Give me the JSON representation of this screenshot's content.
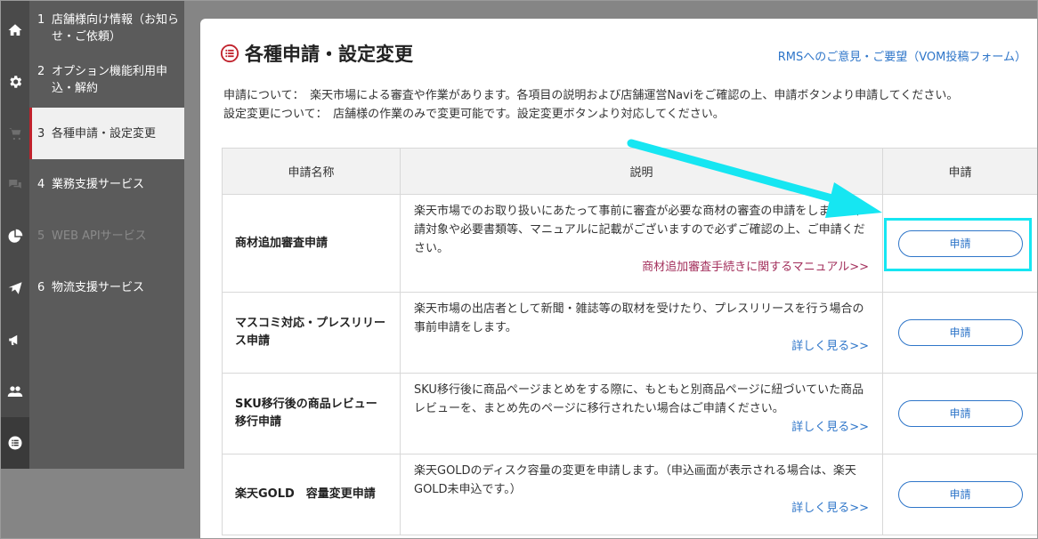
{
  "icon_bar": {
    "icons": [
      {
        "name": "home-icon"
      },
      {
        "name": "gear-icon"
      },
      {
        "name": "cart-icon"
      },
      {
        "name": "chat-icon"
      },
      {
        "name": "pie-chart-icon"
      },
      {
        "name": "paper-plane-icon"
      },
      {
        "name": "megaphone-icon"
      },
      {
        "name": "people-icon"
      },
      {
        "name": "list-icon"
      }
    ]
  },
  "menu": {
    "items": [
      {
        "num": "1",
        "label": "店舗様向け情報（お知らせ・ご依頼）"
      },
      {
        "num": "2",
        "label": "オプション機能利用申込・解約"
      },
      {
        "num": "3",
        "label": "各種申請・設定変更"
      },
      {
        "num": "4",
        "label": "業務支援サービス"
      },
      {
        "num": "5",
        "label": "WEB APIサービス"
      },
      {
        "num": "6",
        "label": "物流支援サービス"
      }
    ]
  },
  "page": {
    "title": "各種申請・設定変更",
    "feedback_link": "RMSへのご意見・ご要望（VOM投稿フォーム）",
    "desc_line1": "申請について：　楽天市場による審査や作業があります。各項目の説明および店舗運営Naviをご確認の上、申請ボタンより申請してください。",
    "desc_line2": "設定変更について：　店舗様の作業のみで変更可能です。設定変更ボタンより対応してください。"
  },
  "table": {
    "headers": [
      "申請名称",
      "説明",
      "申請"
    ],
    "rows": [
      {
        "name": "商材追加審査申請",
        "description": "楽天市場でのお取り扱いにあたって事前に審査が必要な商材の審査の申請をします。申請対象や必要書類等、マニュアルに記載がございますので必ずご確認の上、ご申請ください。",
        "link": "商材追加審査手続きに関するマニュアル>>",
        "button": "申請"
      },
      {
        "name": "マスコミ対応・プレスリリース申請",
        "description": "楽天市場の出店者として新聞・雑誌等の取材を受けたり、プレスリリースを行う場合の事前申請をします。",
        "link": "詳しく見る>>",
        "button": "申請"
      },
      {
        "name": "SKU移行後の商品レビュー移行申請",
        "description": "SKU移行後に商品ページまとめをする際に、もともと別商品ページに紐づいていた商品レビューを、まとめ先のページに移行されたい場合はご申請ください。",
        "link": "詳しく見る>>",
        "button": "申請"
      },
      {
        "name": "楽天GOLD　容量変更申請",
        "description": "楽天GOLDのディスク容量の変更を申請します。（申込画面が表示される場合は、楽天GOLD未申込です。）",
        "link": "詳しく見る>>",
        "button": "申請"
      }
    ]
  },
  "colors": {
    "accent_red": "#c0212b",
    "link_blue": "#2f76c9",
    "highlight_cyan": "#16e6f2"
  }
}
